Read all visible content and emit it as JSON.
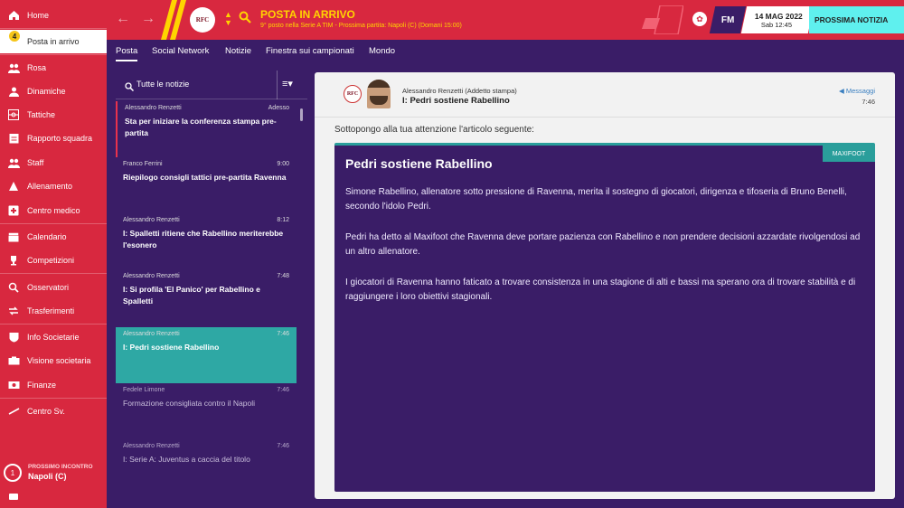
{
  "sidebar": {
    "items": [
      {
        "label": "Home",
        "icon": "home-icon"
      },
      {
        "label": "Posta in arrivo",
        "icon": "inbox-icon"
      },
      {
        "label": "Rosa",
        "icon": "squad-icon"
      },
      {
        "label": "Dinamiche",
        "icon": "dynamics-icon"
      },
      {
        "label": "Tattiche",
        "icon": "tactics-icon"
      },
      {
        "label": "Rapporto squadra",
        "icon": "report-icon"
      },
      {
        "label": "Staff",
        "icon": "staff-icon"
      },
      {
        "label": "Allenamento",
        "icon": "training-icon"
      },
      {
        "label": "Centro medico",
        "icon": "medical-icon"
      },
      {
        "label": "Calendario",
        "icon": "calendar-icon"
      },
      {
        "label": "Competizioni",
        "icon": "trophy-icon"
      },
      {
        "label": "Osservatori",
        "icon": "scout-icon"
      },
      {
        "label": "Trasferimenti",
        "icon": "transfer-icon"
      },
      {
        "label": "Info Societarie",
        "icon": "club-info-icon"
      },
      {
        "label": "Visione societaria",
        "icon": "vision-icon"
      },
      {
        "label": "Finanze",
        "icon": "finance-icon"
      },
      {
        "label": "Centro Sv.",
        "icon": "development-icon"
      }
    ],
    "inbox_badge": "4",
    "next_match_label": "PROSSIMO INCONTRO",
    "next_match_value": "Napoli (C)",
    "next_match_count": "1"
  },
  "topbar": {
    "title": "POSTA IN ARRIVO",
    "subtitle": "9° posto nella Serie A TIM - Prossima partita: Napoli (C) (Domani 15:00)",
    "crest_text": "RFC",
    "fm": "FM",
    "date": "14 MAG 2022",
    "day_time": "Sab 12:45",
    "next_button": "PROSSIMA NOTIZIA",
    "accent": "#d8283f",
    "title_color": "#ffd400"
  },
  "tabs": [
    "Posta",
    "Social Network",
    "Notizie",
    "Finestra sui campionati",
    "Mondo"
  ],
  "list": {
    "filter": "Tutte le notizie",
    "messages": [
      {
        "from": "Alessandro Renzetti",
        "time": "Adesso",
        "subject": "Sta per iniziare la conferenza stampa pre-partita"
      },
      {
        "from": "Franco Ferrini",
        "time": "9:00",
        "subject": "Riepilogo consigli tattici pre-partita Ravenna"
      },
      {
        "from": "Alessandro Renzetti",
        "time": "8:12",
        "subject": "I: Spalletti ritiene che Rabellino meriterebbe l'esonero"
      },
      {
        "from": "Alessandro Renzetti",
        "time": "7:48",
        "subject": "I: Si profila 'El Panico' per Rabellino e Spalletti"
      },
      {
        "from": "Alessandro Renzetti",
        "time": "7:46",
        "subject": "I: Pedri sostiene Rabellino"
      },
      {
        "from": "Fedele Limone",
        "time": "7:46",
        "subject": "Formazione consigliata contro il Napoli"
      },
      {
        "from": "Alessandro Renzetti",
        "time": "7:46",
        "subject": "I: Serie A: Juventus a caccia del titolo"
      }
    ]
  },
  "message": {
    "sender": "Alessandro Renzetti",
    "role": "(Addetto stampa)",
    "subject": "I: Pedri sostiene Rabellino",
    "back_label": "Messaggi",
    "time": "7:46",
    "crest_text": "RFC",
    "intro": "Sottopongo alla tua attenzione l'articolo seguente:",
    "article": {
      "source": "MAXIFOOT",
      "title": "Pedri sostiene Rabellino",
      "paragraphs": [
        "Simone Rabellino, allenatore sotto pressione di Ravenna, merita il sostegno di giocatori, dirigenza e tifoseria di Bruno Benelli, secondo l'idolo Pedri.",
        "Pedri ha detto al Maxifoot che Ravenna deve portare pazienza con Rabellino e non prendere decisioni azzardate rivolgendosi ad un altro allenatore.",
        "I giocatori di Ravenna hanno faticato a trovare consistenza in una stagione di alti e bassi ma sperano ora di trovare stabilità e di raggiungere i loro obiettivi stagionali."
      ]
    }
  }
}
